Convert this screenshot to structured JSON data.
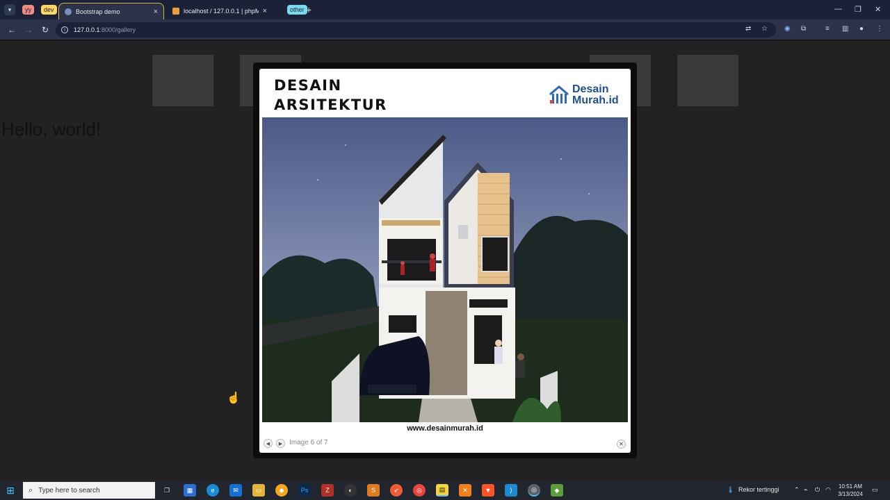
{
  "browser": {
    "groups": [
      "yy",
      "dev",
      "other"
    ],
    "tabs": [
      {
        "label": "Bootstrap demo",
        "active": true
      },
      {
        "label": "localhost / 127.0.0.1 | phpMyAdmin",
        "active": false
      }
    ],
    "url_host": "127.0.0.1",
    "url_path": ":8000/gallery",
    "colors": {
      "tab_group_yy": "#f28b82",
      "tab_group_dev": "#fdd663",
      "tab_group_other": "#78d9ec",
      "active_tab_border": "#d6b94a"
    }
  },
  "page": {
    "heading": "Hello, world!"
  },
  "lightbox": {
    "poster_title_line1": "DESAIN",
    "poster_title_line2": "ARSITEKTUR",
    "brand_line1": "Desain",
    "brand_line2": "Murah.id",
    "website": "www.desainmurah.id",
    "counter": "Image 6 of 7",
    "prev_icon": "arrow-left-icon",
    "next_icon": "arrow-right-icon",
    "close_icon": "close-icon"
  },
  "taskbar": {
    "search_placeholder": "Type here to search",
    "weather_text": "Rekor tertinggi",
    "time": "10:51 AM",
    "date": "3/13/2024"
  }
}
